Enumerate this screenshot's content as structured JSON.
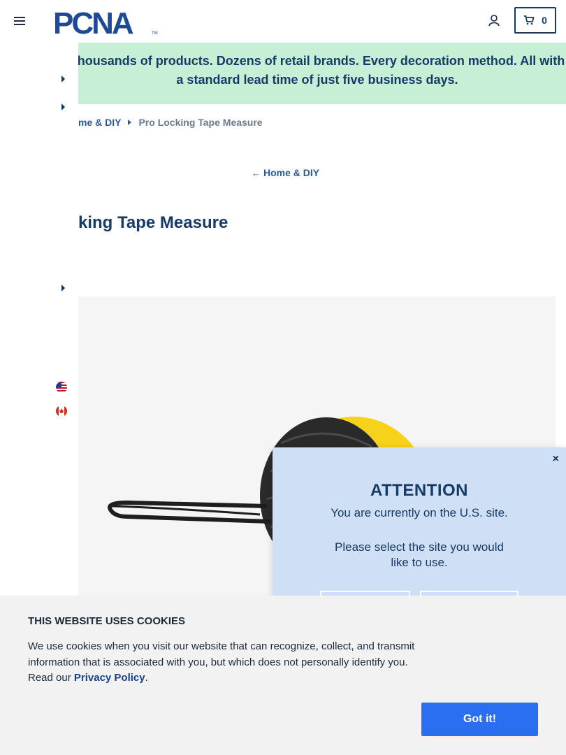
{
  "header": {
    "logo_text": "PCNA",
    "logo_mark": "TM",
    "cart_count": "0"
  },
  "banner": {
    "text": "Thousands of products. Dozens of retail brands. Every decoration method. All with a standard lead time of just five business days."
  },
  "breadcrumb": {
    "parent": "me & DIY",
    "current": "Pro Locking Tape Measure"
  },
  "back_link": {
    "arrow": "←",
    "label": "Home & DIY"
  },
  "page_title": "king Tape Measure",
  "modal": {
    "close_glyph": "×",
    "title": "ATTENTION",
    "line1": "You are currently on the U.S. site.",
    "line2": "Please select the site you would like to use."
  },
  "cookie": {
    "title": "THIS WEBSITE USES COOKIES",
    "text_before": "We use cookies when you visit our website that can recognize, collect, and transmit information that is associated with you, but which does not personally identify you. Read our ",
    "link": "Privacy Policy",
    "text_after": ".",
    "button": "Got it!"
  },
  "colors": {
    "brand_navy": "#163b66",
    "banner_bg": "#c6efd6",
    "modal_bg": "#cfdff5",
    "accept_button": "#2a6ff1",
    "tape_yellow": "#f7d21a"
  },
  "icons": [
    "hamburger-menu-icon",
    "account-icon",
    "cart-icon",
    "us-flag-icon",
    "canada-flag-icon",
    "close-icon",
    "back-arrow-icon"
  ]
}
